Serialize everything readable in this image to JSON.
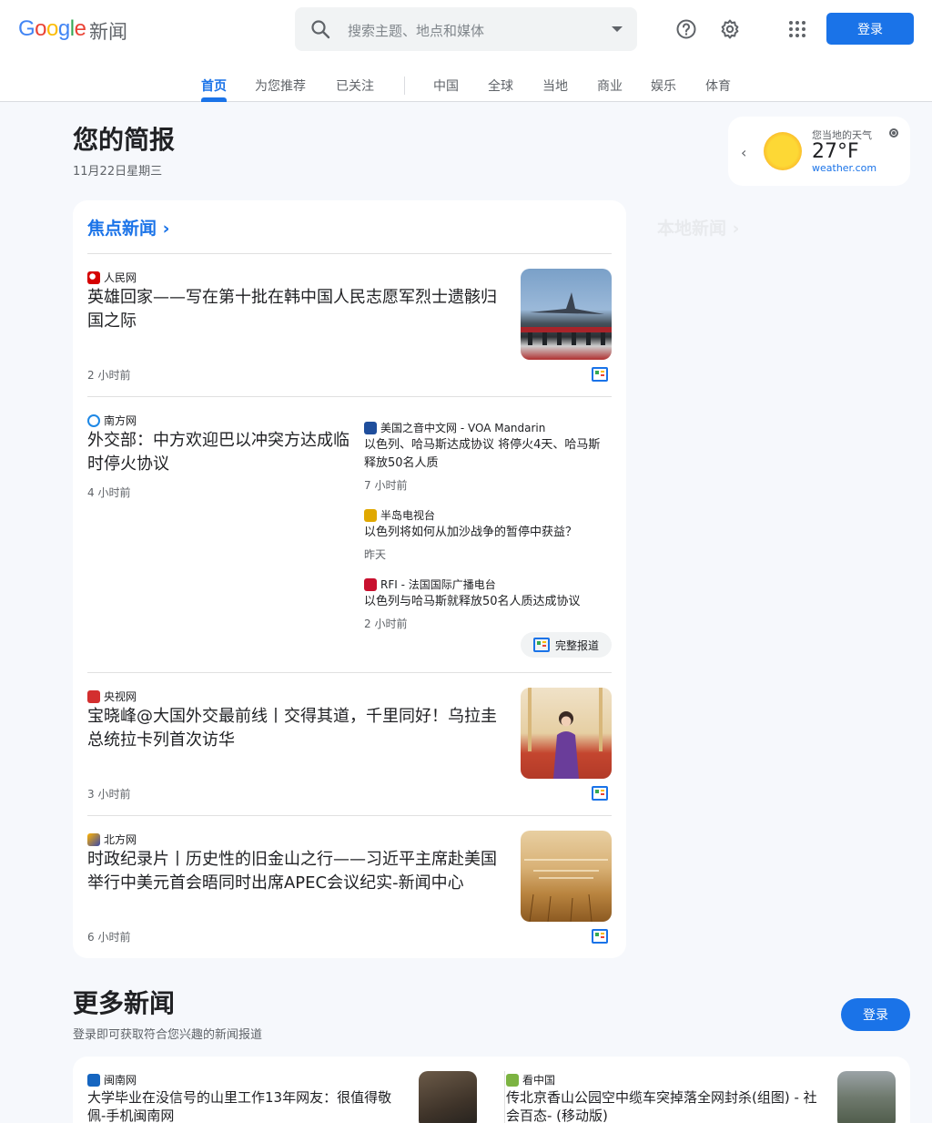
{
  "header": {
    "logo": "Google",
    "product": "新闻",
    "search_placeholder": "搜索主题、地点和媒体",
    "login_label": "登录",
    "icons": [
      "help-icon",
      "settings-icon",
      "apps-grid-icon"
    ]
  },
  "nav": {
    "tabs": [
      {
        "label": "首页",
        "active": true
      },
      {
        "label": "为您推荐"
      },
      {
        "label": "已关注"
      },
      {
        "label": "中国"
      },
      {
        "label": "全球"
      },
      {
        "label": "当地"
      },
      {
        "label": "商业"
      },
      {
        "label": "娱乐"
      },
      {
        "label": "体育"
      }
    ]
  },
  "briefing": {
    "title": "您的简报",
    "date": "11月22日星期三"
  },
  "weather": {
    "label": "您当地的天气",
    "temperature": "27°F",
    "source": "weather.com"
  },
  "local_news": {
    "title": "本地新闻"
  },
  "top_stories": {
    "title": "焦点新闻",
    "stories": [
      {
        "source": "人民网",
        "headline": "英雄回家——写在第十批在韩中国人民志愿军烈士遗骸归国之际",
        "time": "2 小时前"
      },
      {
        "source": "南方网",
        "headline": "外交部：中方欢迎巴以冲突方达成临时停火协议",
        "time": "4 小时前",
        "related": [
          {
            "source": "美国之音中文网 - VOA Mandarin",
            "headline": "以色列、哈马斯达成协议 将停火4天、哈马斯释放50名人质",
            "time": "7 小时前"
          },
          {
            "source": "半岛电视台",
            "headline": "以色列将如何从加沙战争的暂停中获益？",
            "time": "昨天"
          },
          {
            "source": "RFI - 法国国际广播电台",
            "headline": "以色列与哈马斯就释放50名人质达成协议",
            "time": "2 小时前"
          }
        ],
        "full_coverage_label": "完整报道"
      },
      {
        "source": "央视网",
        "headline": "宝晓峰@大国外交最前线丨交得其道，千里同好！乌拉圭总统拉卡列首次访华",
        "time": "3 小时前"
      },
      {
        "source": "北方网",
        "headline": "时政纪录片丨历史性的旧金山之行——习近平主席赴美国举行中美元首会晤同时出席APEC会议纪实-新闻中心",
        "time": "6 小时前"
      }
    ]
  },
  "more_news": {
    "title": "更多新闻",
    "subtitle": "登录即可获取符合您兴趣的新闻报道",
    "login_label": "登录",
    "stories": [
      {
        "source": "闽南网",
        "headline": "大学毕业在没信号的山里工作13年网友：很值得敬佩-手机闽南网"
      },
      {
        "source": "看中国",
        "headline": "传北京香山公园空中缆车突掉落全网封杀(组图) - 社会百态- (移动版)"
      }
    ]
  }
}
